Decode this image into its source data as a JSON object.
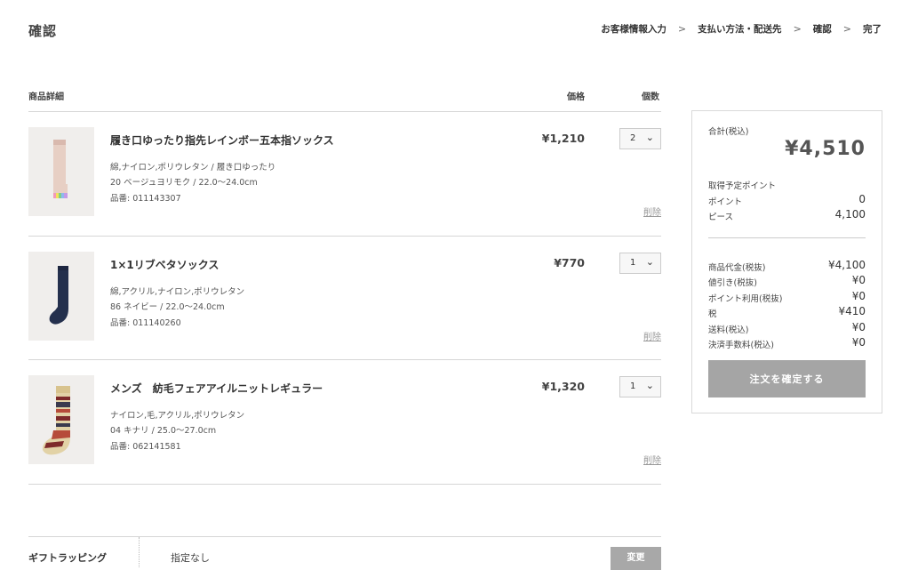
{
  "header": {
    "title": "確認",
    "steps": [
      "お客様情報入力",
      "支払い方法・配送先",
      "確認",
      "完了"
    ],
    "step_separator": ">"
  },
  "columns": {
    "details": "商品詳細",
    "price": "価格",
    "qty": "個数"
  },
  "items": [
    {
      "name": "履き口ゆったり指先レインボー五本指ソックス",
      "material": "綿,ナイロン,ポリウレタン / 履き口ゆったり",
      "variant": "20 ベージュヨリモク / 22.0〜24.0cm",
      "sku": "品番: 011143307",
      "price": "¥1,210",
      "qty": "2",
      "delete": "削除",
      "image_icon": "rainbow-toe-sock"
    },
    {
      "name": "1×1リブベタソックス",
      "material": "綿,アクリル,ナイロン,ポリウレタン",
      "variant": "86 ネイビー / 22.0〜24.0cm",
      "sku": "品番: 011140260",
      "price": "¥770",
      "qty": "1",
      "delete": "削除",
      "image_icon": "navy-rib-sock"
    },
    {
      "name": "メンズ　紡毛フェアアイルニットレギュラー",
      "material": "ナイロン,毛,アクリル,ポリウレタン",
      "variant": "04 キナリ / 25.0〜27.0cm",
      "sku": "品番: 062141581",
      "price": "¥1,320",
      "qty": "1",
      "delete": "削除",
      "image_icon": "fair-isle-sock"
    }
  ],
  "summary": {
    "total_label": "合計(税込)",
    "total_value": "¥4,510",
    "points_title": "取得予定ポイント",
    "points_label": "ポイント",
    "points_value": "0",
    "piece_label": "ピース",
    "piece_value": "4,100",
    "rows": [
      {
        "label": "商品代金(税抜)",
        "value": "¥4,100"
      },
      {
        "label": "値引き(税抜)",
        "value": "¥0"
      },
      {
        "label": "ポイント利用(税抜)",
        "value": "¥0"
      },
      {
        "label": "税",
        "value": "¥410"
      },
      {
        "label": "送料(税込)",
        "value": "¥0"
      },
      {
        "label": "決済手数料(税込)",
        "value": "¥0"
      }
    ],
    "confirm_button": "注文を確定する"
  },
  "gift": {
    "label": "ギフトラッピング",
    "value": "指定なし",
    "change_button": "変更"
  },
  "colors": {
    "button_gray": "#a5a5a5",
    "border": "#d6d6d6",
    "text": "#333333"
  }
}
